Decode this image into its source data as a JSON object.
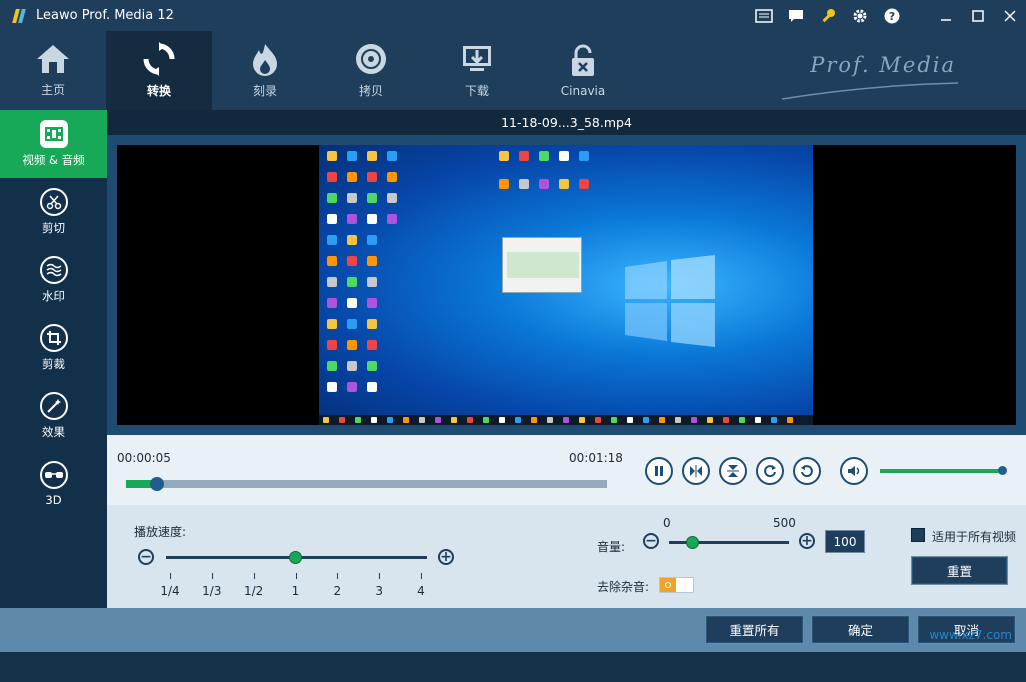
{
  "app": {
    "title": "Leawo Prof. Media 12",
    "brand": "Prof. Media"
  },
  "window_buttons": [
    "monitor-icon",
    "chat-icon",
    "key-icon",
    "gear-icon",
    "help-icon",
    "minimize-icon",
    "maximize-icon",
    "close-icon"
  ],
  "nav": [
    {
      "label": "主页",
      "icon": "home-icon"
    },
    {
      "label": "转换",
      "icon": "convert-icon",
      "active": true
    },
    {
      "label": "刻录",
      "icon": "burn-icon"
    },
    {
      "label": "拷贝",
      "icon": "copy-disc-icon"
    },
    {
      "label": "下载",
      "icon": "download-icon"
    },
    {
      "label": "Cinavia",
      "icon": "unlock-icon"
    }
  ],
  "sidebar": [
    {
      "label": "视频 & 音频",
      "icon": "film-icon",
      "active": true
    },
    {
      "label": "剪切",
      "icon": "scissors-icon"
    },
    {
      "label": "水印",
      "icon": "watermark-icon"
    },
    {
      "label": "剪裁",
      "icon": "crop-icon"
    },
    {
      "label": "效果",
      "icon": "effect-icon"
    },
    {
      "label": "3D",
      "icon": "3d-glasses-icon"
    }
  ],
  "video": {
    "filename": "11-18-09...3_58.mp4",
    "current_time": "00:00:05",
    "total_time": "00:01:18",
    "progress": 0.065,
    "volume_level": 0.98
  },
  "playback_buttons": [
    "pause-icon",
    "flip-horizontal-icon",
    "flip-vertical-icon",
    "rotate-clockwise-icon",
    "rotate-counterclockwise-icon",
    "volume-icon"
  ],
  "settings": {
    "speed_label": "播放速度:",
    "speed_ticks": [
      "1/4",
      "1/3",
      "1/2",
      "1",
      "2",
      "3",
      "4"
    ],
    "speed_selected_index": 3,
    "volume_label": "音量:",
    "volume_min": "0",
    "volume_max": "500",
    "volume_value": "100",
    "volume_fraction": 0.2,
    "denoise_label": "去除杂音:",
    "denoise_on": false,
    "apply_all_label": "适用于所有视频",
    "reset_label": "重置"
  },
  "footer": {
    "reset_all_label": "重置所有",
    "ok_label": "确定",
    "cancel_label": "取消"
  },
  "watermark": "www.xz7.com"
}
